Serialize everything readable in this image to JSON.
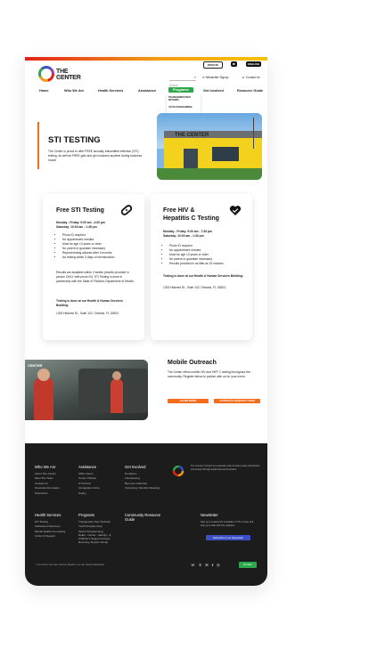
{
  "header": {
    "logo_text": "THE CENTER",
    "logo_sub": "GAYCENTERORLANDO.ORG",
    "donate_label": "DONATE",
    "store_icon": "bag-icon",
    "english_label": "ENGLISH",
    "search_placeholder": "Search",
    "newsletter_label": "Newsletter Signup",
    "contact_label": "Contact Us"
  },
  "nav": {
    "items": [
      "Home",
      "Who We Are",
      "Health Services",
      "Assistance",
      "Programs",
      "Get Involved",
      "Resource Guide"
    ],
    "active": "Programs",
    "dropdown": [
      "TRANSGENDER PEER NETWORK",
      "YOUTH PROGRAMMING",
      "SENIOR PROGRAMMING"
    ]
  },
  "hero": {
    "title": "STI TESTING",
    "text": "The Center is proud to offer FREE sexually transmitted infection (STI) testing, as well as FREE gels and gel condoms anytime during business hours!"
  },
  "card_sti": {
    "title": "Free STI Testing",
    "hours_1": "Monday - Friday: 9:00 am - 4:00 pm",
    "hours_2": "Saturday: 10:00 am - 1:45 pm",
    "bullets": [
      "Photo ID required",
      "No appointment needed",
      "Must be age 13 years or older",
      "No parent or guardian necessary",
      "Repeat testing allowed after 3 months",
      "No testing within 3 days of menstruation"
    ],
    "results": "Results are available within 2 weeks (results provided in person ONLY with photo ID). STI Testing is done in partnership with the State of Florida's Department of Health.",
    "location_title": "Testing is done at our Health & Human Services Building:",
    "address": "1300 Hillcrest St., Suite 102, Orlando, FL 32803."
  },
  "card_hiv": {
    "title_1": "Free HIV &",
    "title_2": "Hepatitis C Testing",
    "hours_1": "Monday - Friday: 9:00 am - 7:45 pm",
    "hours_2": "Saturday: 10:00 am - 1:30 pm",
    "bullets": [
      "Photo ID required",
      "No appointment needed",
      "Must be age 13 years or older",
      "No parent or guardian necessary",
      "Results provided in as little as 15 minutes"
    ],
    "location_title": "Testing is done at our Health & Human Services Building:",
    "address": "1300 Hillcrest St., Suite 102, Orlando, FL 32803."
  },
  "outreach": {
    "title": "Mobile Outreach",
    "text": "The Center offers mobile HIV and HEP C testing throughout the community. Register below to partner with us for your event.",
    "btn_1": "LEARN MORE",
    "btn_2": "OUTREACH REQUEST FORM"
  },
  "footer": {
    "about": "The Center's mission is to educate and promote a safe and tolerant community through awareness and inclusion.",
    "col1": {
      "title": "Who We Are",
      "items": [
        "About The Center",
        "Meet The Team",
        "Contact Us",
        "Financial Information",
        "Directories"
      ]
    },
    "col2": {
      "title": "Assistance",
      "items": [
        "Office Hours",
        "Center Policies",
        "CTCV/LLF",
        "Immigration Clinic",
        "Notary"
      ]
    },
    "col3": {
      "title": "Get Involved",
      "items": [
        "Donations",
        "Volunteering",
        "Become a Member",
        "Upcoming / Monthly Meetings"
      ]
    },
    "col4": {
      "title": "Health Services",
      "items": [
        "STI Testing",
        "Adolescent Recovery",
        "Mental Health Counseling",
        "Circle Of Support"
      ]
    },
    "col5": {
      "title": "Programs",
      "items": [
        "Transgender Peer Network",
        "Youth Programming",
        "Senior Programming",
        "Dollar - Center - Identity - & Children's Support Groups",
        "Recovery Support Group"
      ]
    },
    "col6": {
      "title": "Community Resource Guide"
    },
    "newsletter": {
      "title": "Newsletter",
      "text": "Sign up to receive the newsletter of The Center and stay up to date with the programs.",
      "button": "Subscribe to our Newsletter"
    },
    "copyright": "© COPYRIGHT 2022 GAY CENTER ORLANDO, INC. ALL RIGHTS RESERVED.",
    "donate": "Donate",
    "social_icons": [
      "phone-icon",
      "location-icon",
      "mail-icon",
      "facebook-icon",
      "instagram-icon"
    ]
  },
  "colors": {
    "orange": "#f26c1c",
    "green": "#2ea84a",
    "dark": "#1c1c1c",
    "blue": "#3d4fc4"
  }
}
